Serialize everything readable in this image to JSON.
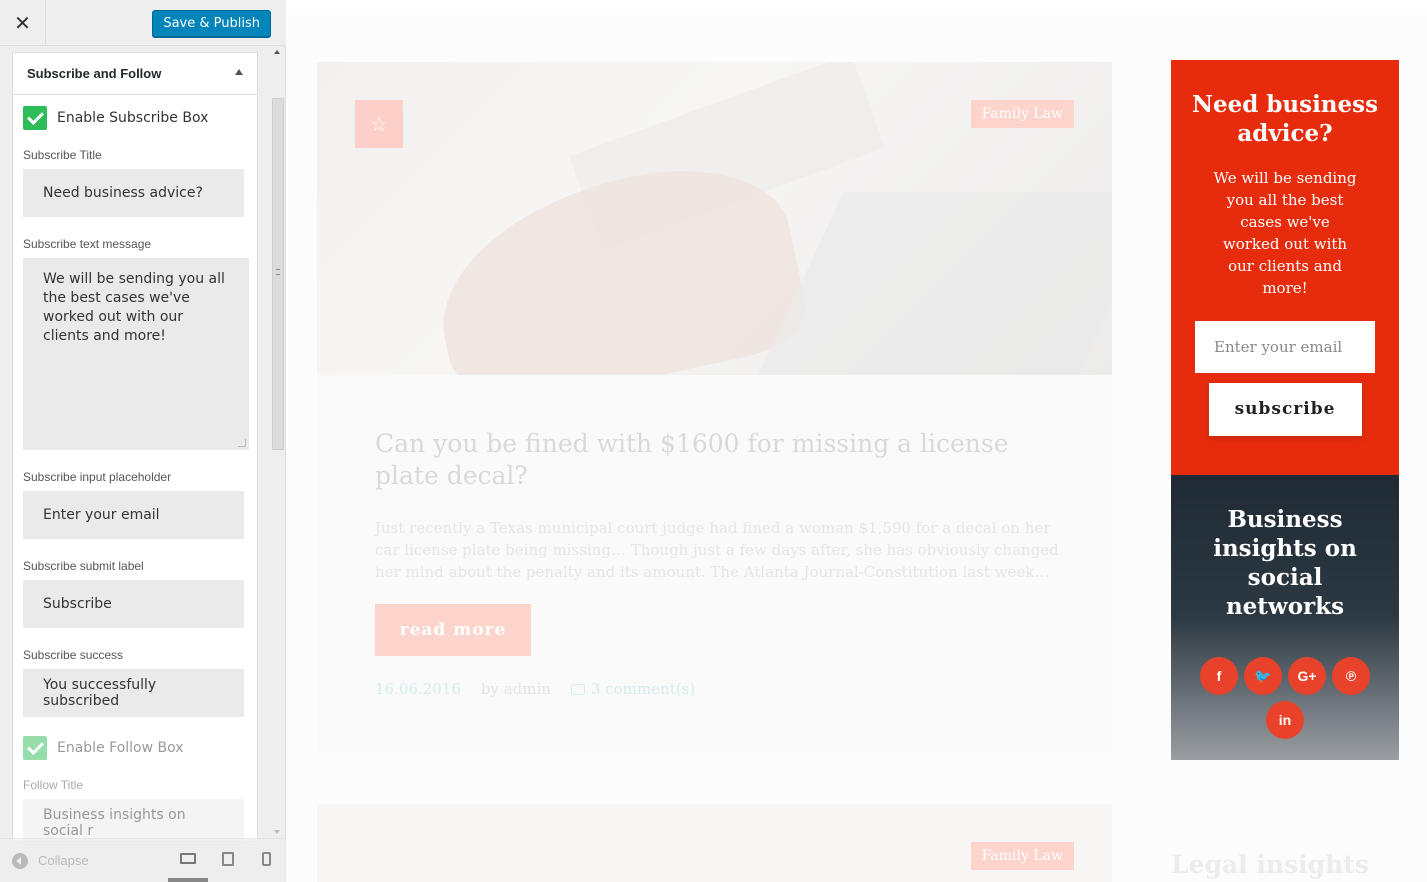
{
  "customizer": {
    "close_label": "✕",
    "publish_label": "Save & Publish",
    "section_title": "Subscribe and Follow",
    "enable_subscribe_label": "Enable Subscribe Box",
    "fields": {
      "subscribe_title_label": "Subscribe Title",
      "subscribe_title_value": "Need business advice?",
      "subscribe_text_label": "Subscribe text message",
      "subscribe_text_value": "We will be sending you all the best cases we've worked out with our clients and more!",
      "subscribe_placeholder_label": "Subscribe input placeholder",
      "subscribe_placeholder_value": "Enter your email",
      "subscribe_submit_label": "Subscribe submit label",
      "subscribe_submit_value": "Subscribe",
      "subscribe_success_label": "Subscribe success",
      "subscribe_success_value": "You successfully subscribed",
      "enable_follow_label": "Enable Follow Box",
      "follow_title_label": "Follow Title",
      "follow_title_value": "Business insights on social r"
    },
    "footer": {
      "collapse_label": "Collapse"
    }
  },
  "preview": {
    "post": {
      "category": "Family Law",
      "star_icon": "☆",
      "title": "Can you be fined with $1600 for missing a license plate decal?",
      "excerpt": "Just recently a Texas municipal court judge had fined a woman $1,590 for a decal on her car license plate being missing… Though just a few days after, she has obviously changed her mind about the penalty and its amount. The Atlanta Journal-Constitution last week…",
      "read_more": "read more",
      "date": "16.06.2016",
      "author": "by admin",
      "comments": "3 comment(s)"
    },
    "post2": {
      "category": "Family Law"
    },
    "subscribe_widget": {
      "title": "Need business advice?",
      "text": "We will be sending you all the best cases we've worked out with our clients and more!",
      "placeholder": "Enter your email",
      "button": "subscribe",
      "color": "#e62c0d"
    },
    "social_widget": {
      "title": "Business insights on social networks",
      "icons": [
        {
          "name": "facebook-icon",
          "glyph": "f"
        },
        {
          "name": "twitter-icon",
          "glyph": "🐦"
        },
        {
          "name": "google-plus-icon",
          "glyph": "G+"
        },
        {
          "name": "pinterest-icon",
          "glyph": "℗"
        },
        {
          "name": "linkedin-icon",
          "glyph": "in"
        }
      ],
      "icon_color": "#e8432a"
    },
    "legal_title": "Legal insights"
  }
}
